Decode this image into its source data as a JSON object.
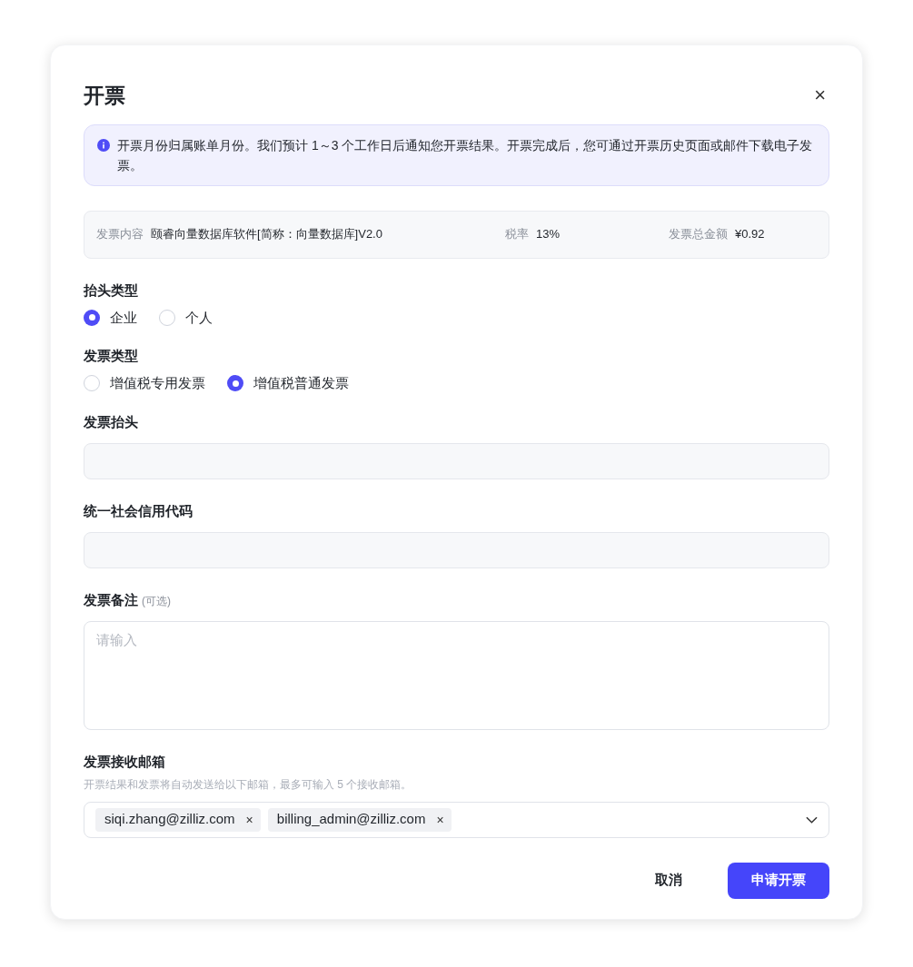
{
  "dialog": {
    "title": "开票",
    "close": "×"
  },
  "notice": "开票月份归属账单月份。我们预计 1～3 个工作日后通知您开票结果。开票完成后，您可通过开票历史页面或邮件下载电子发票。",
  "summary": [
    {
      "label": "发票内容",
      "value": "颐睿向量数据库软件[简称：向量数据库]V2.0"
    },
    {
      "label": "税率",
      "value": "13%"
    },
    {
      "label": "发票总金额",
      "value": "¥0.92"
    }
  ],
  "fields": [
    {
      "kind": "radio",
      "label": "抬头类型",
      "options": [
        {
          "label": "企业",
          "selected": true
        },
        {
          "label": "个人",
          "selected": false
        }
      ]
    },
    {
      "kind": "radio",
      "label": "发票类型",
      "options": [
        {
          "label": "增值税专用发票",
          "selected": false
        },
        {
          "label": "增值税普通发票",
          "selected": true
        }
      ]
    },
    {
      "kind": "input",
      "label": "发票抬头"
    },
    {
      "kind": "input",
      "label": "统一社会信用代码"
    },
    {
      "kind": "textarea",
      "label": "发票备注",
      "optional": "(可选)",
      "placeholder": "请输入"
    },
    {
      "kind": "tags",
      "label": "发票接收邮箱",
      "hint": "开票结果和发票将自动发送给以下邮箱，最多可输入 5 个接收邮箱。",
      "tags": [
        "siqi.zhang@zilliz.com",
        "billing_admin@zilliz.com"
      ],
      "remove": "×"
    }
  ],
  "buttons": [
    {
      "label": "取消",
      "kind": "secondary"
    },
    {
      "label": "申请开票",
      "kind": "primary"
    }
  ]
}
